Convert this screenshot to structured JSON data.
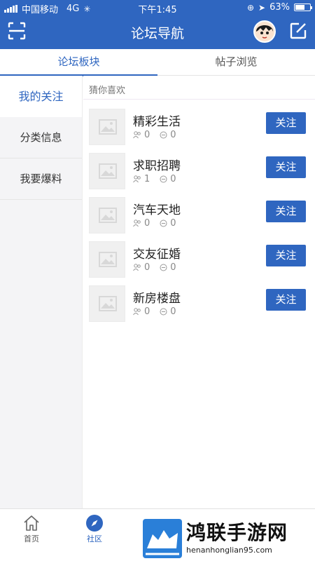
{
  "status_bar": {
    "carrier": "中国移动",
    "network": "4G",
    "time": "下午1:45",
    "battery": "63%",
    "battery_level": 0.63
  },
  "header": {
    "title": "论坛导航",
    "scan_icon": "scan-icon",
    "avatar": "avatar",
    "edit_icon": "edit-icon"
  },
  "tabs": [
    {
      "label": "论坛板块",
      "active": true
    },
    {
      "label": "帖子浏览",
      "active": false
    }
  ],
  "sidebar": {
    "items": [
      {
        "label": "我的关注",
        "active": true
      },
      {
        "label": "分类信息",
        "active": false
      },
      {
        "label": "我要爆料",
        "active": false
      }
    ]
  },
  "main": {
    "section_label": "猜你喜欢",
    "forums": [
      {
        "name": "精彩生活",
        "members": "0",
        "posts": "0",
        "follow_label": "关注"
      },
      {
        "name": "求职招聘",
        "members": "1",
        "posts": "0",
        "follow_label": "关注"
      },
      {
        "name": "汽车天地",
        "members": "0",
        "posts": "0",
        "follow_label": "关注"
      },
      {
        "name": "交友征婚",
        "members": "0",
        "posts": "0",
        "follow_label": "关注"
      },
      {
        "name": "新房楼盘",
        "members": "0",
        "posts": "0",
        "follow_label": "关注"
      }
    ]
  },
  "bottom_nav": [
    {
      "label": "首页",
      "icon": "home-icon",
      "active": false
    },
    {
      "label": "社区",
      "icon": "compass-icon",
      "active": true
    }
  ],
  "watermark": {
    "title": "鸿联手游网",
    "url": "henanhonglian95.com"
  },
  "colors": {
    "primary": "#2f66c0",
    "sidebar_bg": "#f4f4f6"
  }
}
